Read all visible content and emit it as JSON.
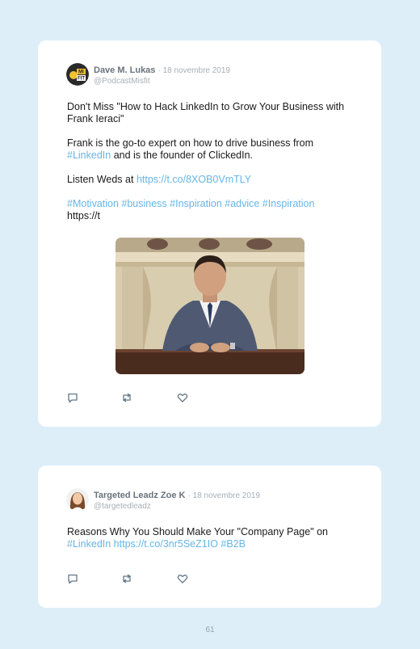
{
  "tweets": [
    {
      "author": "Dave M. Lukas",
      "date": "· 18 novembre 2019",
      "handle": "@PodcastMisfit",
      "avatar_text": "MI FIT",
      "p1": "Don't Miss \"How to Hack LinkedIn to Grow Your Business with Frank Ieraci\"",
      "p2_a": "Frank is the go-to expert on how to drive business from",
      "p2_tag": "#LinkedIn",
      "p2_b": "and is the founder of ClickedIn.",
      "p3_a": "Listen Weds at",
      "p3_link": "https://t.co/8XOB0VmTLY",
      "p4_tags": "#Motivation #business #Inspiration #advice #Inspiration",
      "p4_tail": "https://t",
      "icons": [
        "reply-icon",
        "retweet-icon",
        "like-icon"
      ]
    },
    {
      "author": "Targeted Leadz Zoe K",
      "date": "· 18 novembre 2019",
      "handle": "@targetedleadz",
      "p1": "Reasons Why You Should Make Your \"Company Page\" on",
      "p2": "#LinkedIn https://t.co/3nr5SeZ1IO #B2B",
      "icons": [
        "reply-icon",
        "retweet-icon",
        "like-icon"
      ]
    }
  ],
  "page_number": "61",
  "colors": {
    "background": "#ddeef8",
    "card": "#ffffff",
    "link": "#64b6e6",
    "name": "#69727c",
    "meta": "#a7afb6"
  }
}
